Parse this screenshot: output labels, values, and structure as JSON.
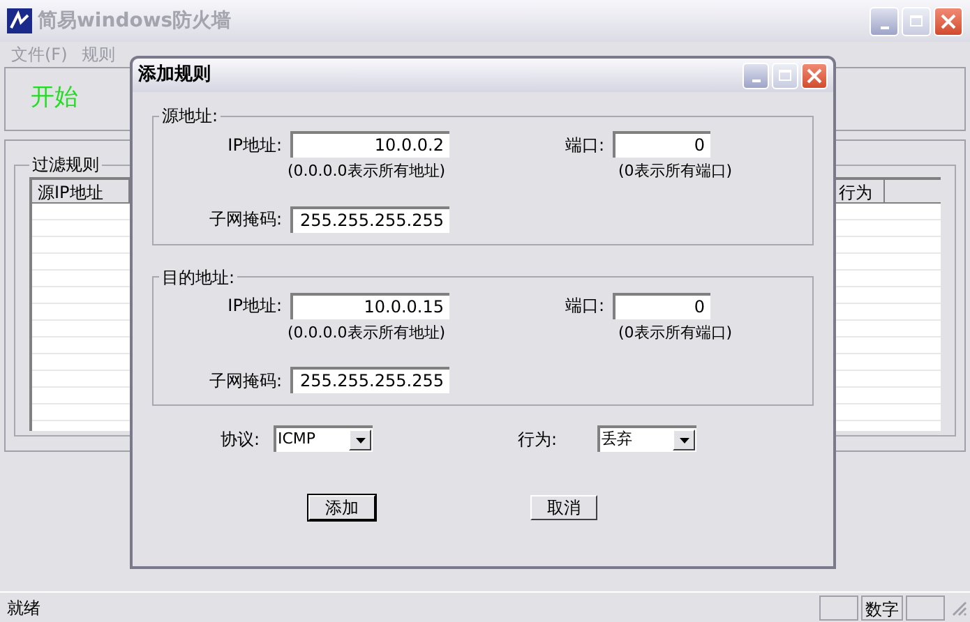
{
  "window": {
    "title": "简易windows防火墙"
  },
  "menu": [
    {
      "label": "文件(F)"
    },
    {
      "label": "规则"
    }
  ],
  "toolbar": [
    {
      "label": "开始"
    }
  ],
  "filter_group": {
    "title": "过滤规则",
    "columns": [
      "源IP地址",
      "行为"
    ]
  },
  "dialog": {
    "title": "添加规则",
    "sections": [
      {
        "title": "源地址:",
        "ip_label": "IP地址:",
        "ip": "10.0.0.2",
        "ip_hint": "(0.0.0.0表示所有地址)",
        "port_label": "端口:",
        "port": "0",
        "port_hint": "(0表示所有端口)",
        "mask_label": "子网掩码:",
        "mask": "255.255.255.255"
      },
      {
        "title": "目的地址:",
        "ip_label": "IP地址:",
        "ip": "10.0.0.15",
        "ip_hint": "(0.0.0.0表示所有地址)",
        "port_label": "端口:",
        "port": "0",
        "port_hint": "(0表示所有端口)",
        "mask_label": "子网掩码:",
        "mask": "255.255.255.255"
      }
    ],
    "protocol": {
      "label": "协议:",
      "value": "ICMP"
    },
    "action": {
      "label": "行为:",
      "value": "丢弃"
    },
    "buttons": [
      {
        "label": "添加",
        "default": true
      },
      {
        "label": "取消",
        "default": false
      }
    ]
  },
  "status_bar": {
    "text": "就绪",
    "panes": [
      {
        "text": "数字"
      }
    ]
  }
}
